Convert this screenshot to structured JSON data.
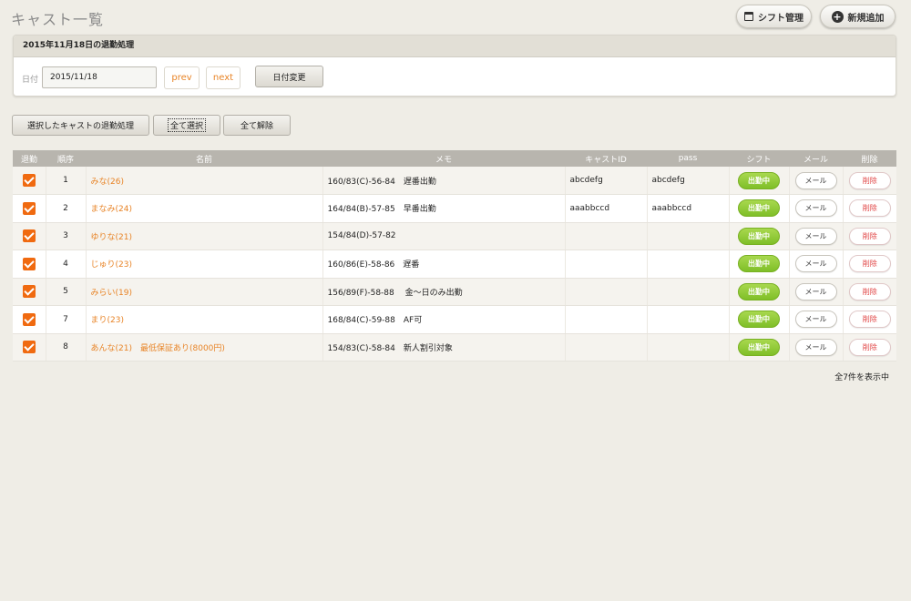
{
  "page": {
    "title": "キャスト一覧",
    "shift_button_label": "シフト管理",
    "new_button_label": "新規追加"
  },
  "panel": {
    "title": "2015年11月18日の退勤処理",
    "date_label": "日付",
    "date_value": "2015/11/18",
    "prev_label": "prev",
    "next_label": "next",
    "date_change_label": "日付変更"
  },
  "actions": {
    "checkout_selected_label": "選択したキャストの退勤処理",
    "select_all_label": "全て選択",
    "deselect_all_label": "全て解除"
  },
  "table": {
    "headers": [
      "退勤",
      "順序",
      "名前",
      "メモ",
      "キャストID",
      "pass",
      "シフト",
      "メール",
      "削除"
    ],
    "rows": [
      {
        "checked": true,
        "order": "1",
        "name": "みな(26)",
        "memo": "160/83(C)-56-84　遅番出勤",
        "cast_id": "abcdefg",
        "pass": "abcdefg",
        "shift": "出勤中",
        "mail": "メール",
        "delete": "削除"
      },
      {
        "checked": true,
        "order": "2",
        "name": "まなみ(24)",
        "memo": "164/84(B)-57-85　早番出勤",
        "cast_id": "aaabbccd",
        "pass": "aaabbccd",
        "shift": "出勤中",
        "mail": "メール",
        "delete": "削除"
      },
      {
        "checked": true,
        "order": "3",
        "name": "ゆりな(21)",
        "memo": "154/84(D)-57-82",
        "cast_id": "",
        "pass": "",
        "shift": "出勤中",
        "mail": "メール",
        "delete": "削除"
      },
      {
        "checked": true,
        "order": "4",
        "name": "じゅり(23)",
        "memo": "160/86(E)-58-86　遅番",
        "cast_id": "",
        "pass": "",
        "shift": "出勤中",
        "mail": "メール",
        "delete": "削除"
      },
      {
        "checked": true,
        "order": "5",
        "name": "みらい(19)",
        "memo": "156/89(F)-58-88　 金〜日のみ出勤",
        "cast_id": "",
        "pass": "",
        "shift": "出勤中",
        "mail": "メール",
        "delete": "削除"
      },
      {
        "checked": true,
        "order": "7",
        "name": "まり(23)",
        "memo": "168/84(C)-59-88　AF可",
        "cast_id": "",
        "pass": "",
        "shift": "出勤中",
        "mail": "メール",
        "delete": "削除"
      },
      {
        "checked": true,
        "order": "8",
        "name": "あんな(21)　最低保証あり(8000円)",
        "memo": "154/83(C)-58-84　新人割引対象",
        "cast_id": "",
        "pass": "",
        "shift": "出勤中",
        "mail": "メール",
        "delete": "削除"
      }
    ]
  },
  "footer": {
    "count_text": "全7件を表示中"
  }
}
